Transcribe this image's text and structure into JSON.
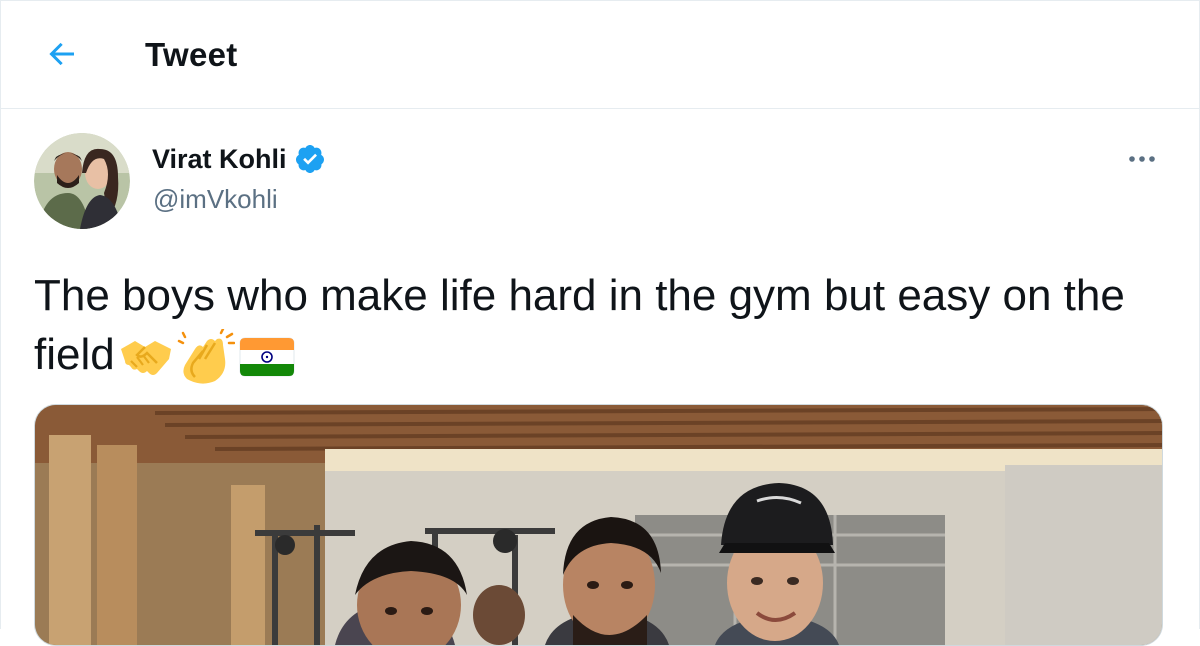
{
  "header": {
    "title": "Tweet",
    "back_icon": "arrow-left-icon"
  },
  "tweet": {
    "author_name": "Virat Kohli",
    "handle": "@imVkohli",
    "verified": true,
    "text": "The boys who make life hard in the gym but easy on the field",
    "emojis": [
      "handshake-emoji",
      "clapping-hands-emoji",
      "india-flag-emoji"
    ],
    "more_icon": "more-horizontal-icon"
  },
  "colors": {
    "accent": "#1da1f2",
    "text": "#0f1419",
    "secondary_text": "#5b7083",
    "border": "#e6ecf0"
  }
}
